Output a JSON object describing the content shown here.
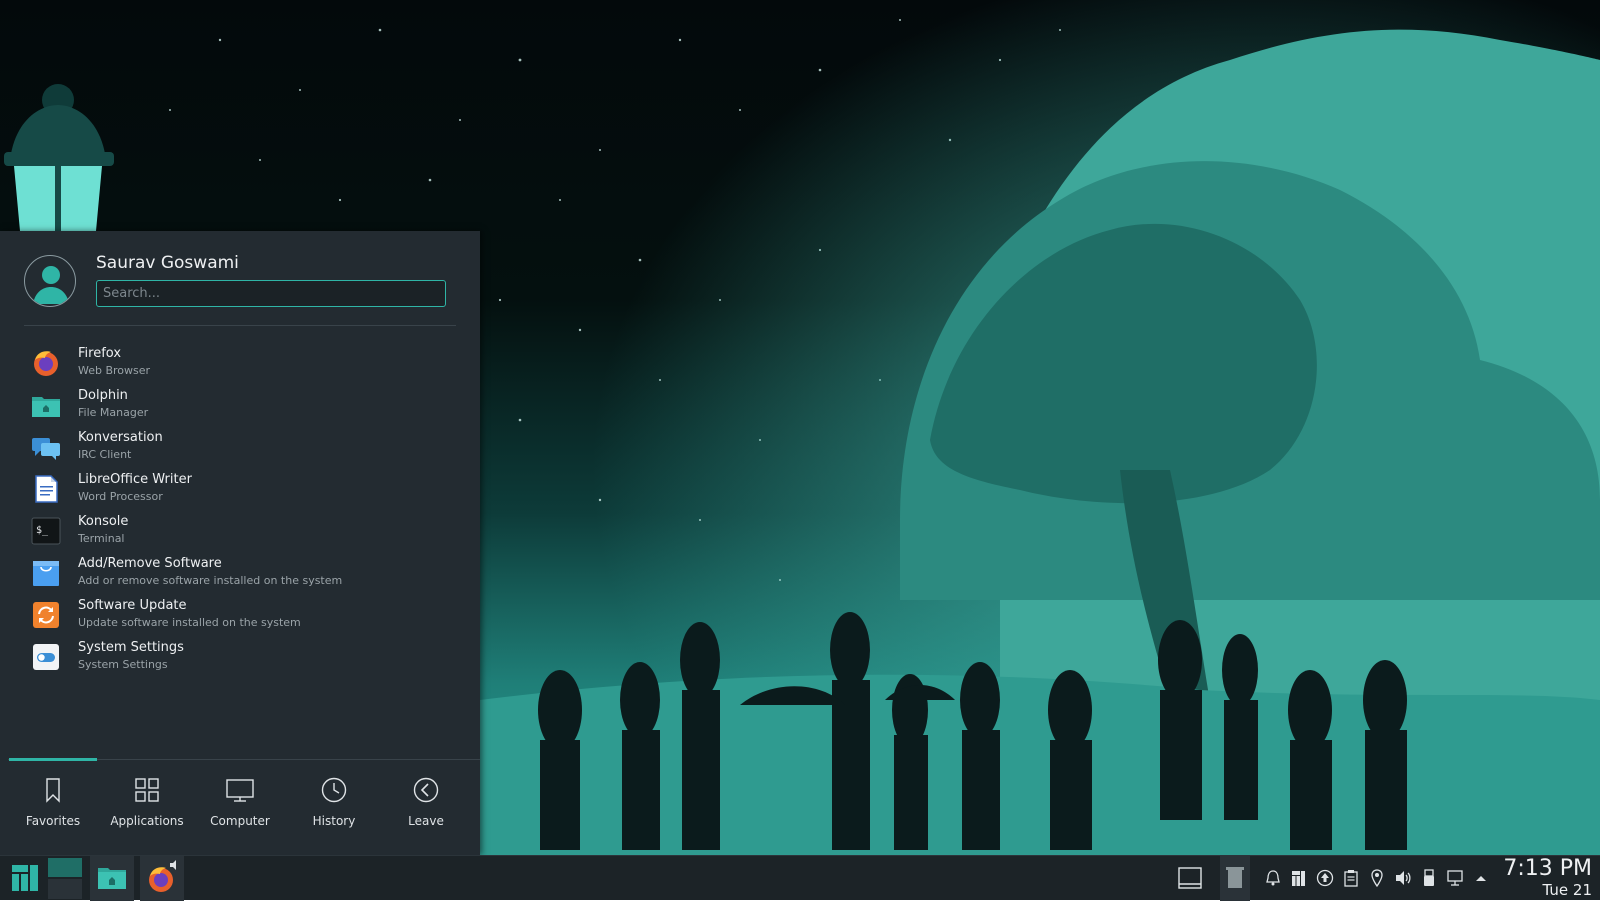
{
  "launcher": {
    "user_name": "Saurav Goswami",
    "search_placeholder": "Search...",
    "apps": [
      {
        "name": "Firefox",
        "description": "Web Browser",
        "icon": "firefox-icon"
      },
      {
        "name": "Dolphin",
        "description": "File Manager",
        "icon": "dolphin-folder-icon"
      },
      {
        "name": "Konversation",
        "description": "IRC Client",
        "icon": "konversation-chat-icon"
      },
      {
        "name": "LibreOffice Writer",
        "description": "Word Processor",
        "icon": "writer-document-icon"
      },
      {
        "name": "Konsole",
        "description": "Terminal",
        "icon": "terminal-icon"
      },
      {
        "name": "Add/Remove Software",
        "description": "Add or remove software installed on the system",
        "icon": "shopping-bag-icon"
      },
      {
        "name": "Software Update",
        "description": "Update software installed on the system",
        "icon": "update-arrows-icon"
      },
      {
        "name": "System Settings",
        "description": "System Settings",
        "icon": "settings-toggle-icon"
      }
    ],
    "tabs": [
      {
        "label": "Favorites",
        "icon": "bookmark-icon",
        "active": true
      },
      {
        "label": "Applications",
        "icon": "grid-icon",
        "active": false
      },
      {
        "label": "Computer",
        "icon": "monitor-icon",
        "active": false
      },
      {
        "label": "History",
        "icon": "clock-icon",
        "active": false
      },
      {
        "label": "Leave",
        "icon": "back-circle-icon",
        "active": false
      }
    ]
  },
  "taskbar": {
    "clock_time": "7:13 PM",
    "clock_date": "Tue 21"
  },
  "colors": {
    "accent": "#2fb5a6",
    "menu_bg": "#232b31",
    "taskbar_bg": "#1c2327"
  }
}
